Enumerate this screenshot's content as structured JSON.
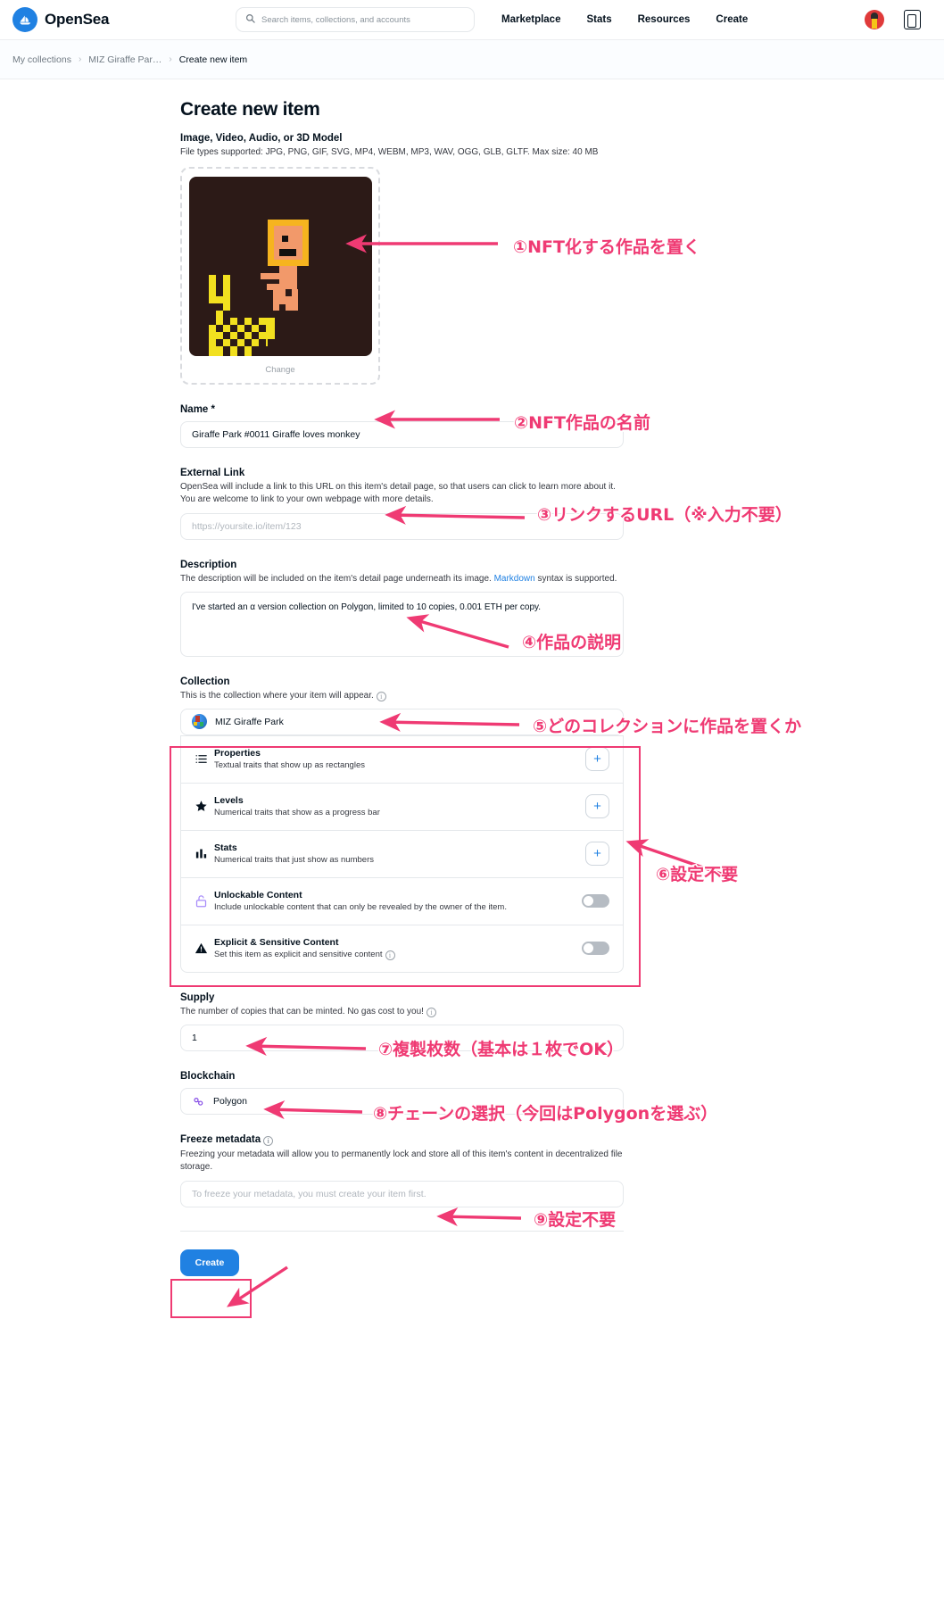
{
  "header": {
    "brand": "OpenSea",
    "logo_icon": "opensea-logo-icon",
    "search_placeholder": "Search items, collections, and accounts",
    "search_value": "",
    "nav": [
      {
        "label": "Marketplace"
      },
      {
        "label": "Stats"
      },
      {
        "label": "Resources"
      },
      {
        "label": "Create"
      }
    ],
    "avatar_icon": "user-avatar",
    "wallet_icon": "wallet-icon"
  },
  "breadcrumb": {
    "items": [
      {
        "label": "My collections"
      },
      {
        "label": "MIZ Giraffe Par…"
      },
      {
        "label": "Create new item"
      }
    ],
    "separator": "›"
  },
  "main": {
    "title": "Create new item",
    "media": {
      "label": "Image, Video, Audio, or 3D Model",
      "helper": "File types supported: JPG, PNG, GIF, SVG, MP4, WEBM, MP3, WAV, OGG, GLB, GLTF. Max size: 40 MB",
      "change_label": "Change"
    },
    "name": {
      "label": "Name *",
      "value": "Giraffe Park #0011 Giraffe loves monkey"
    },
    "external_link": {
      "label": "External Link",
      "helper": "OpenSea will include a link to this URL on this item's detail page, so that users can click to learn more about it. You are welcome to link to your own webpage with more details.",
      "placeholder": "https://yoursite.io/item/123",
      "value": ""
    },
    "description": {
      "label": "Description",
      "helper_before": "The description will be included on the item's detail page underneath its image. ",
      "helper_link": "Markdown",
      "helper_after": " syntax is supported.",
      "value": "I've started an α version collection on Polygon, limited to 10 copies, 0.001 ETH per copy."
    },
    "collection": {
      "label": "Collection",
      "helper": "This is the collection where your item will appear.",
      "value": "MIZ Giraffe Park",
      "info_icon": "info-icon",
      "avatar_icon": "collection-avatar"
    },
    "traits": [
      {
        "icon": "list-icon",
        "name": "Properties",
        "desc": "Textual traits that show up as rectangles",
        "control": "plus",
        "control_label": "+"
      },
      {
        "icon": "star-icon",
        "name": "Levels",
        "desc": "Numerical traits that show as a progress bar",
        "control": "plus",
        "control_label": "+"
      },
      {
        "icon": "bar-chart-icon",
        "name": "Stats",
        "desc": "Numerical traits that just show as numbers",
        "control": "plus",
        "control_label": "+"
      },
      {
        "icon": "unlock-icon",
        "name": "Unlockable Content",
        "desc": "Include unlockable content that can only be revealed by the owner of the item.",
        "control": "toggle",
        "control_state": "off"
      },
      {
        "icon": "warning-icon",
        "name": "Explicit & Sensitive Content",
        "desc": "Set this item as explicit and sensitive content",
        "control": "toggle",
        "control_state": "off",
        "has_info": true
      }
    ],
    "supply": {
      "label": "Supply",
      "helper": "The number of copies that can be minted. No gas cost to you!",
      "value": "1"
    },
    "blockchain": {
      "label": "Blockchain",
      "value": "Polygon",
      "icon": "polygon-icon"
    },
    "freeze": {
      "label": "Freeze metadata",
      "helper": "Freezing your metadata will allow you to permanently lock and store all of this item's content in decentralized file storage.",
      "placeholder": "To freeze your metadata, you must create your item first."
    },
    "create_button": "Create"
  },
  "annotations": {
    "color": "#ef3a73",
    "items": [
      {
        "id": "a1",
        "text": "①NFT化する作品を置く"
      },
      {
        "id": "a2",
        "text": "②NFT作品の名前"
      },
      {
        "id": "a3",
        "text": "③リンクするURL（※入力不要）"
      },
      {
        "id": "a4",
        "text": "④作品の説明"
      },
      {
        "id": "a5",
        "text": "⑤どのコレクションに作品を置くか"
      },
      {
        "id": "a6",
        "text": "⑥設定不要"
      },
      {
        "id": "a7",
        "text": "⑦複製枚数（基本は１枚でOK）"
      },
      {
        "id": "a8",
        "text": "⑧チェーンの選択（今回はPolygonを選ぶ）"
      },
      {
        "id": "a9",
        "text": "⑨設定不要"
      }
    ]
  }
}
